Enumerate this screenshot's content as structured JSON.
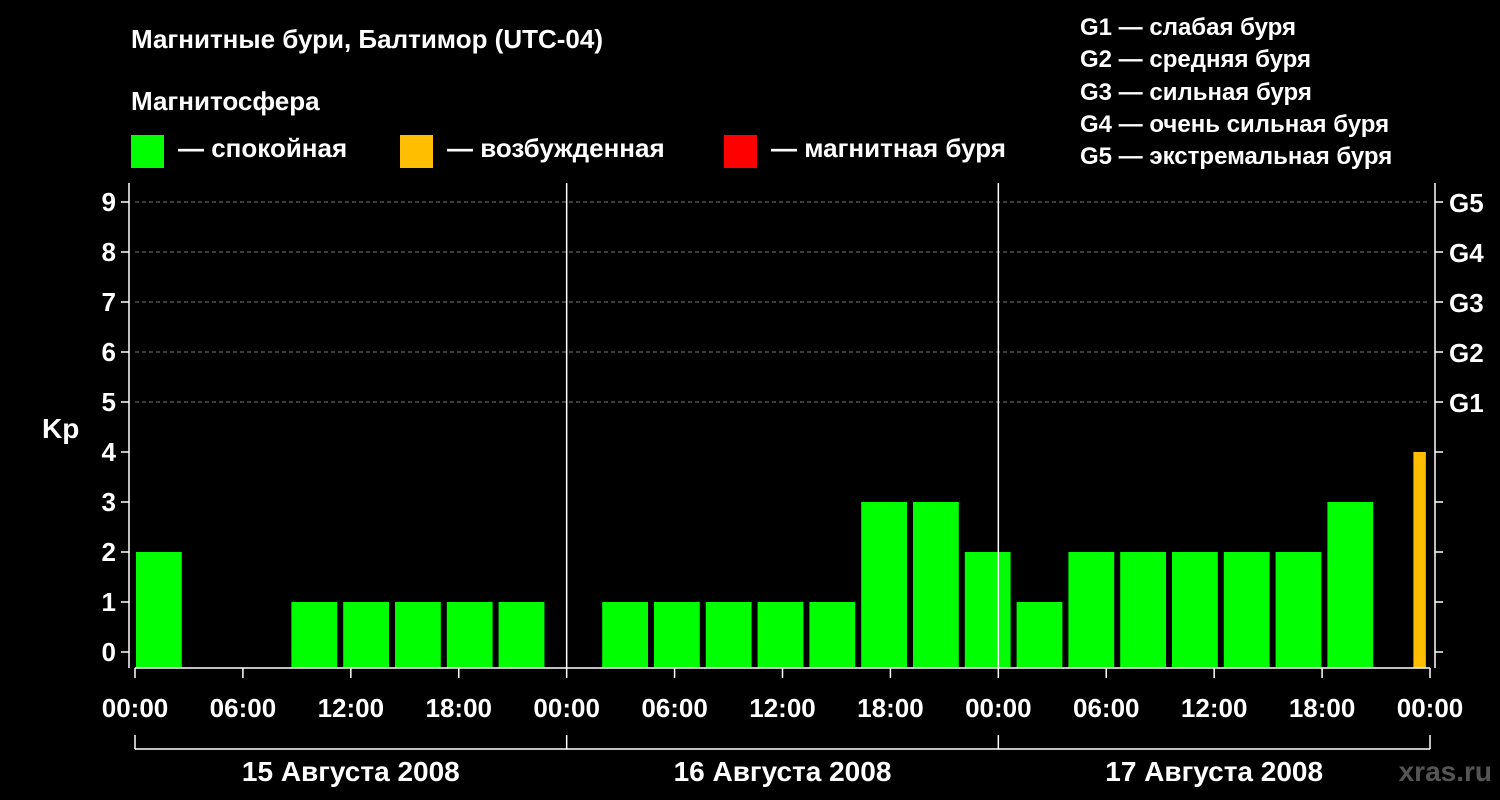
{
  "title": "Магнитные бури, Балтимор (UTC-04)",
  "magnetosphere": {
    "label": "Магнитосфера",
    "states": [
      {
        "label": "— спокойная",
        "color": "#00ff00"
      },
      {
        "label": "— возбужденная",
        "color": "#ffbf00"
      },
      {
        "label": "— магнитная буря",
        "color": "#ff0000"
      }
    ]
  },
  "g_legend": [
    "G1 — слабая буря",
    "G2 — средняя буря",
    "G3 — сильная буря",
    "G4 — очень сильная буря",
    "G5 — экстремальная буря"
  ],
  "watermark": "xras.ru",
  "chart_data": {
    "type": "bar",
    "ylabel": "Kp",
    "ylim": [
      0,
      9
    ],
    "y_ticks": [
      "0",
      "1",
      "2",
      "3",
      "4",
      "5",
      "6",
      "7",
      "8",
      "9"
    ],
    "right_ticks": [
      {
        "value": 5,
        "label": "G1"
      },
      {
        "value": 6,
        "label": "G2"
      },
      {
        "value": 7,
        "label": "G3"
      },
      {
        "value": 8,
        "label": "G4"
      },
      {
        "value": 9,
        "label": "G5"
      }
    ],
    "x_tick_labels": [
      "00:00",
      "06:00",
      "12:00",
      "18:00",
      "00:00",
      "06:00",
      "12:00",
      "18:00",
      "00:00",
      "06:00",
      "12:00",
      "18:00",
      "00:00"
    ],
    "days": [
      "15 Августа 2008",
      "16 Августа 2008",
      "17 Августа 2008"
    ],
    "grid": "dashed horizontal at 5-9",
    "interval_hours": 3,
    "values": [
      2,
      0,
      0,
      1,
      1,
      1,
      1,
      1,
      0,
      1,
      1,
      1,
      1,
      1,
      3,
      3,
      2,
      1,
      2,
      2,
      2,
      2,
      2,
      3,
      4
    ],
    "colors": [
      "#00ff00",
      "#00ff00",
      "#00ff00",
      "#00ff00",
      "#00ff00",
      "#00ff00",
      "#00ff00",
      "#00ff00",
      "#00ff00",
      "#00ff00",
      "#00ff00",
      "#00ff00",
      "#00ff00",
      "#00ff00",
      "#00ff00",
      "#00ff00",
      "#00ff00",
      "#00ff00",
      "#00ff00",
      "#00ff00",
      "#00ff00",
      "#00ff00",
      "#00ff00",
      "#00ff00",
      "#ffbf00"
    ]
  }
}
